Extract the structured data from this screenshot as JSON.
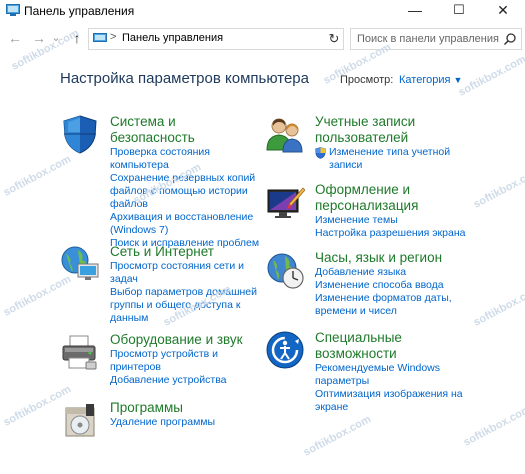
{
  "window": {
    "title": "Панель управления",
    "minimize": "—",
    "maximize": "☐",
    "close": "✕"
  },
  "nav": {
    "back": "←",
    "forward": "→",
    "dropdown": "⌄",
    "up": "↑",
    "address_sep": ">",
    "address_text": "Панель управления",
    "address_dropdown": "⌄",
    "refresh": "↻",
    "search_placeholder": "Поиск в панели управления"
  },
  "main": {
    "title": "Настройка параметров компьютера",
    "view_label": "Просмотр:",
    "view_value": "Категория",
    "view_caret": "▼"
  },
  "categories": [
    {
      "title": "Система и безопасность",
      "icon": "security-shield-icon",
      "links": [
        "Проверка состояния компьютера",
        "Сохранение резервных копий файлов с помощью истории файлов",
        "Архивация и восстановление (Windows 7)",
        "Поиск и исправление проблем"
      ]
    },
    {
      "title": "Сеть и Интернет",
      "icon": "network-globe-icon",
      "links": [
        "Просмотр состояния сети и задач",
        "Выбор параметров домашней группы и общего доступа к данным"
      ]
    },
    {
      "title": "Оборудование и звук",
      "icon": "printer-icon",
      "links": [
        "Просмотр устройств и принтеров",
        "Добавление устройства"
      ]
    },
    {
      "title": "Программы",
      "icon": "programs-disk-icon",
      "links": [
        "Удаление программы"
      ]
    },
    {
      "title": "Учетные записи пользователей",
      "icon": "users-icon",
      "links": [
        "Изменение типа учетной записи"
      ]
    },
    {
      "title": "Оформление и персонализация",
      "icon": "personalization-monitor-icon",
      "links": [
        "Изменение темы",
        "Настройка разрешения экрана"
      ]
    },
    {
      "title": "Часы, язык и регион",
      "icon": "clock-globe-icon",
      "links": [
        "Добавление языка",
        "Изменение способа ввода",
        "Изменение форматов даты, времени и чисел"
      ]
    },
    {
      "title": "Специальные возможности",
      "icon": "ease-of-access-icon",
      "links": [
        "Рекомендуемые Windows параметры",
        "Оптимизация изображения на экране"
      ]
    }
  ],
  "watermark": "softikbox.com"
}
